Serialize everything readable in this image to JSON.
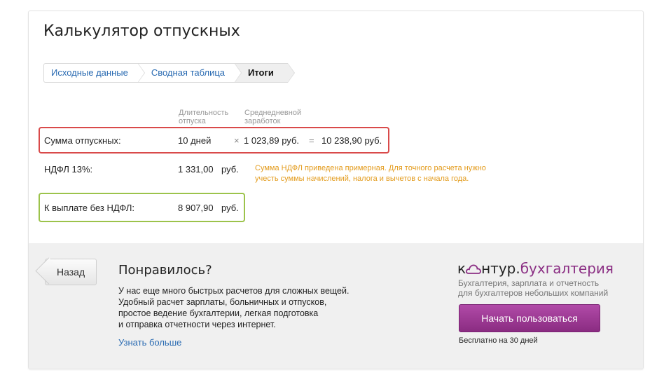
{
  "title": "Калькулятор отпускных",
  "steps": [
    {
      "label": "Исходные данные",
      "active": false
    },
    {
      "label": "Сводная таблица",
      "active": false
    },
    {
      "label": "Итоги",
      "active": true
    }
  ],
  "columns": {
    "duration_line1": "Длительность",
    "duration_line2": "отпуска",
    "avg_line1": "Среднедневной",
    "avg_line2": "заработок"
  },
  "rows": {
    "vacation": {
      "label": "Сумма отпускных:",
      "days": "10 дней",
      "times": "×",
      "avg": "1 023,89 руб.",
      "equals": "=",
      "total": "10 238,90 руб."
    },
    "ndfl": {
      "label": "НДФЛ 13%:",
      "amount": "1 331,00",
      "unit": "руб."
    },
    "payout": {
      "label": "К выплате без НДФЛ:",
      "amount": "8 907,90",
      "unit": "руб."
    }
  },
  "note": {
    "line1": "Сумма НДФЛ приведена примерная. Для точного расчета нужно",
    "line2": "учесть суммы начислений, налога и вычетов с начала года."
  },
  "bottom": {
    "back_label": "Назад",
    "promo_title": "Понравилось?",
    "promo_lines": [
      "У нас еще много быстрых расчетов для сложных вещей.",
      "Удобный расчет зарплаты, больничных и отпусков,",
      "простое ведение бухгалтерии, легкая подготовка",
      "и отправка отчетности через интернет."
    ],
    "learn_more": "Узнать больше",
    "logo_part1": "к",
    "logo_part2": "нтур.",
    "logo_part3": "бухгалтерия",
    "logo_sub_line1": "Бухгалтерия, зарплата и отчетность",
    "logo_sub_line2": "для бухгалтеров небольших компаний",
    "start_label": "Начать пользоваться",
    "free_label": "Бесплатно на 30 дней"
  },
  "colors": {
    "accent_link": "#2a6bb2",
    "red_box": "#d94a4a",
    "green_box": "#9cc34b",
    "note": "#e39b1c",
    "brand": "#8b2f84"
  }
}
